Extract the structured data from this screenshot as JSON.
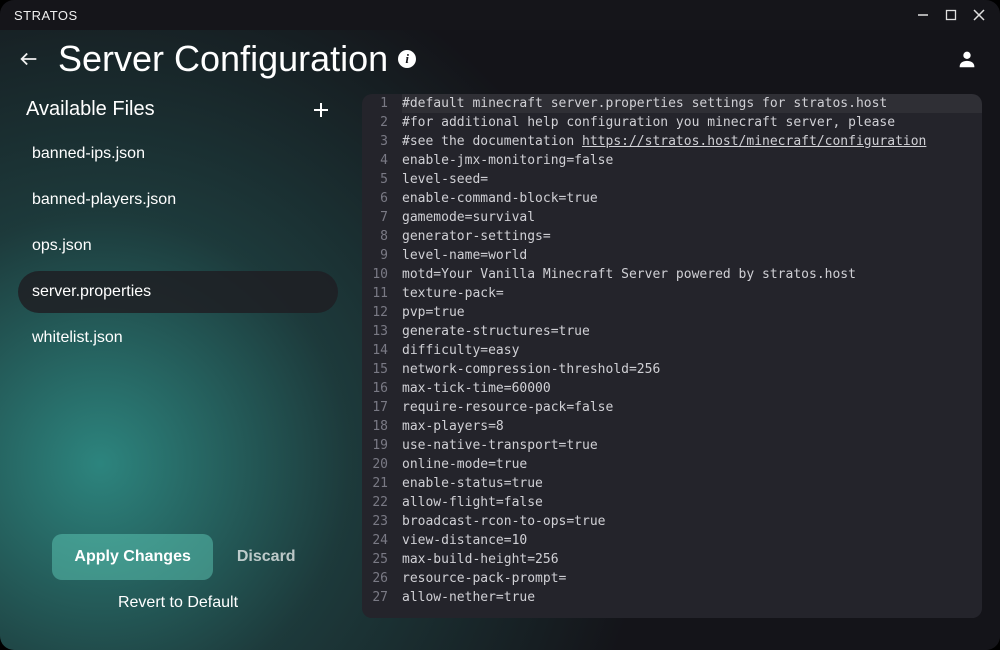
{
  "window": {
    "title": "STRATOS"
  },
  "header": {
    "title": "Server Configuration"
  },
  "sidebar": {
    "title": "Available Files",
    "files": [
      {
        "name": "banned-ips.json",
        "active": false
      },
      {
        "name": "banned-players.json",
        "active": false
      },
      {
        "name": "ops.json",
        "active": false
      },
      {
        "name": "server.properties",
        "active": true
      },
      {
        "name": "whitelist.json",
        "active": false
      }
    ],
    "apply_label": "Apply Changes",
    "discard_label": "Discard",
    "revert_label": "Revert to Default"
  },
  "editor": {
    "lines": [
      "#default minecraft server.properties settings for stratos.host",
      "#for additional help configuration you minecraft server, please",
      "#see the documentation https://stratos.host/minecraft/configuration",
      "enable-jmx-monitoring=false",
      "level-seed=",
      "enable-command-block=true",
      "gamemode=survival",
      "generator-settings=",
      "level-name=world",
      "motd=Your Vanilla Minecraft Server powered by stratos.host",
      "texture-pack=",
      "pvp=true",
      "generate-structures=true",
      "difficulty=easy",
      "network-compression-threshold=256",
      "max-tick-time=60000",
      "require-resource-pack=false",
      "max-players=8",
      "use-native-transport=true",
      "online-mode=true",
      "enable-status=true",
      "allow-flight=false",
      "broadcast-rcon-to-ops=true",
      "view-distance=10",
      "max-build-height=256",
      "resource-pack-prompt=",
      "allow-nether=true"
    ]
  }
}
